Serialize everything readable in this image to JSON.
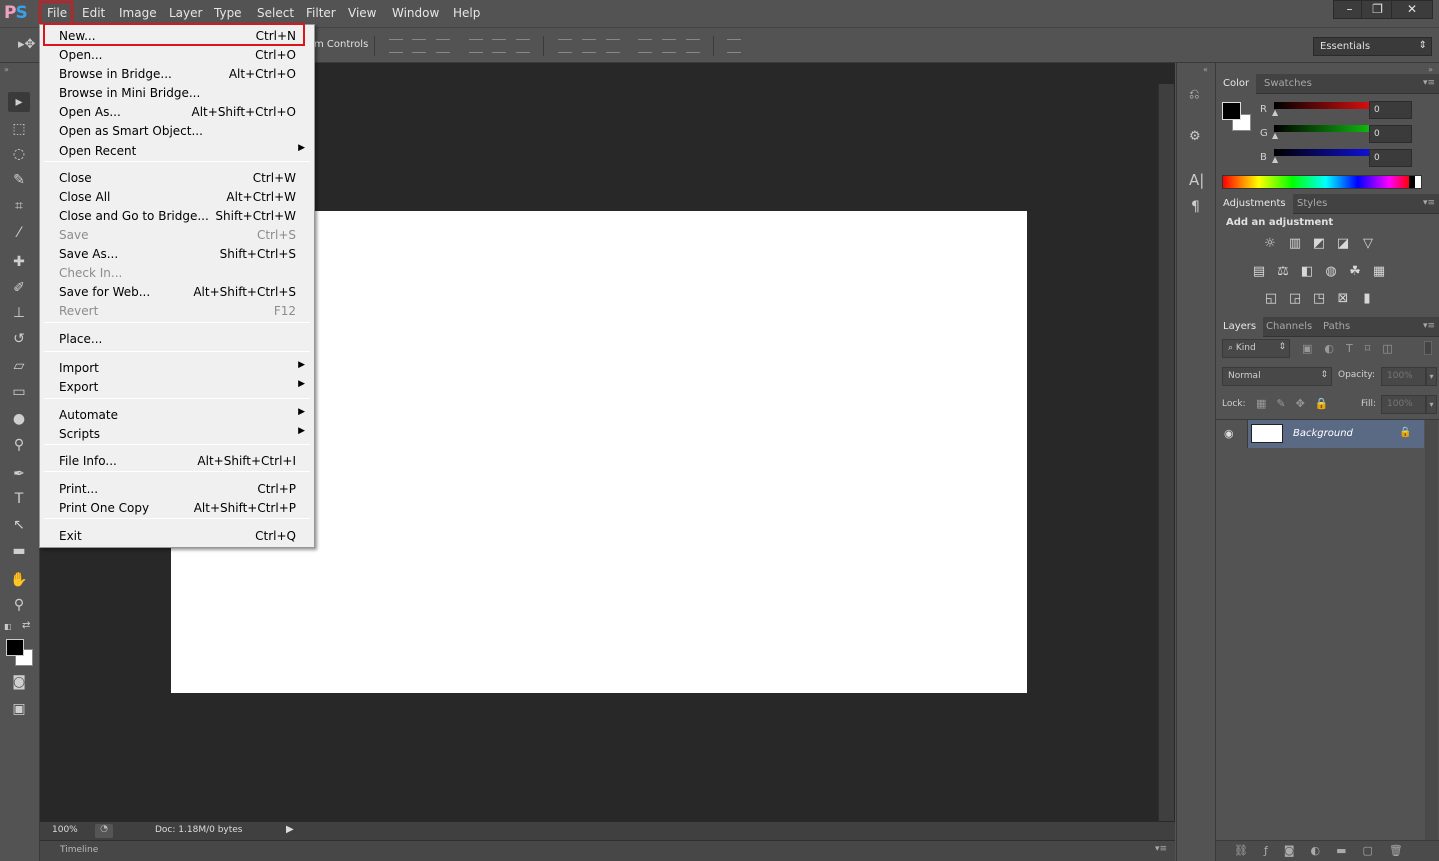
{
  "app": {
    "logo": "PS"
  },
  "menubar": {
    "items": [
      "File",
      "Edit",
      "Image",
      "Layer",
      "Type",
      "Select",
      "Filter",
      "View",
      "Window",
      "Help"
    ]
  },
  "window_controls": {
    "minimize": "–",
    "restore": "❐",
    "close": "✕"
  },
  "options_bar": {
    "transform_label": "m Controls",
    "workspace": "Essentials"
  },
  "status": {
    "zoom": "100%",
    "doc": "Doc: 1.18M/0 bytes",
    "timeline": "Timeline"
  },
  "file_menu": {
    "items": [
      {
        "label": "New...",
        "shortcut": "Ctrl+N",
        "disabled": false
      },
      {
        "label": "Open...",
        "shortcut": "Ctrl+O",
        "disabled": false
      },
      {
        "label": "Browse in Bridge...",
        "shortcut": "Alt+Ctrl+O",
        "disabled": false
      },
      {
        "label": "Browse in Mini Bridge...",
        "shortcut": "",
        "disabled": false
      },
      {
        "label": "Open As...",
        "shortcut": "Alt+Shift+Ctrl+O",
        "disabled": false
      },
      {
        "label": "Open as Smart Object...",
        "shortcut": "",
        "disabled": false
      },
      {
        "label": "Open Recent",
        "shortcut": "",
        "disabled": false,
        "submenu": true
      },
      {
        "label": "Close",
        "shortcut": "Ctrl+W",
        "disabled": false
      },
      {
        "label": "Close All",
        "shortcut": "Alt+Ctrl+W",
        "disabled": false
      },
      {
        "label": "Close and Go to Bridge...",
        "shortcut": "Shift+Ctrl+W",
        "disabled": false
      },
      {
        "label": "Save",
        "shortcut": "Ctrl+S",
        "disabled": true
      },
      {
        "label": "Save As...",
        "shortcut": "Shift+Ctrl+S",
        "disabled": false
      },
      {
        "label": "Check In...",
        "shortcut": "",
        "disabled": true
      },
      {
        "label": "Save for Web...",
        "shortcut": "Alt+Shift+Ctrl+S",
        "disabled": false
      },
      {
        "label": "Revert",
        "shortcut": "F12",
        "disabled": true
      },
      {
        "label": "Place...",
        "shortcut": "",
        "disabled": false
      },
      {
        "label": "Import",
        "shortcut": "",
        "disabled": false,
        "submenu": true
      },
      {
        "label": "Export",
        "shortcut": "",
        "disabled": false,
        "submenu": true
      },
      {
        "label": "Automate",
        "shortcut": "",
        "disabled": false,
        "submenu": true
      },
      {
        "label": "Scripts",
        "shortcut": "",
        "disabled": false,
        "submenu": true
      },
      {
        "label": "File Info...",
        "shortcut": "Alt+Shift+Ctrl+I",
        "disabled": false
      },
      {
        "label": "Print...",
        "shortcut": "Ctrl+P",
        "disabled": false
      },
      {
        "label": "Print One Copy",
        "shortcut": "Alt+Shift+Ctrl+P",
        "disabled": false
      },
      {
        "label": "Exit",
        "shortcut": "Ctrl+Q",
        "disabled": false
      }
    ]
  },
  "color_panel": {
    "tabs": [
      "Color",
      "Swatches"
    ],
    "channels": [
      {
        "label": "R",
        "value": "0",
        "color": "#e01010"
      },
      {
        "label": "G",
        "value": "0",
        "color": "#10c010"
      },
      {
        "label": "B",
        "value": "0",
        "color": "#1010e0"
      }
    ],
    "foreground": "#000000",
    "background": "#ffffff"
  },
  "adjustments_panel": {
    "tabs": [
      "Adjustments",
      "Styles"
    ],
    "heading": "Add an adjustment"
  },
  "layers_panel": {
    "tabs": [
      "Layers",
      "Channels",
      "Paths"
    ],
    "filter_kind": "Kind",
    "blend_mode": "Normal",
    "opacity_label": "Opacity:",
    "opacity_value": "100%",
    "lock_label": "Lock:",
    "fill_label": "Fill:",
    "fill_value": "100%",
    "layers": [
      {
        "name": "Background",
        "visible": true,
        "locked": true
      }
    ]
  }
}
